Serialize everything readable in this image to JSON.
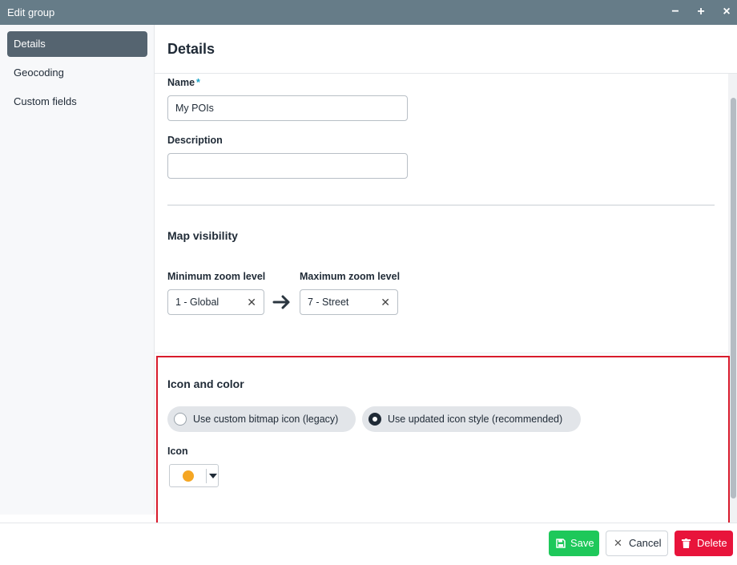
{
  "window": {
    "title": "Edit group",
    "controls": {
      "minimize": "−",
      "maximize": "+",
      "close": "×"
    }
  },
  "sidebar": {
    "items": [
      {
        "label": "Details",
        "active": true
      },
      {
        "label": "Geocoding",
        "active": false
      },
      {
        "label": "Custom fields",
        "active": false
      }
    ]
  },
  "main": {
    "title": "Details",
    "name": {
      "label": "Name",
      "required_mark": "*",
      "value": "My POIs"
    },
    "description": {
      "label": "Description",
      "value": ""
    },
    "map_visibility": {
      "title": "Map visibility",
      "min_zoom": {
        "label": "Minimum zoom level",
        "value": "1 - Global"
      },
      "max_zoom": {
        "label": "Maximum zoom level",
        "value": "7 - Street"
      }
    },
    "icon_and_color": {
      "title": "Icon and color",
      "options": [
        {
          "label": "Use custom bitmap icon (legacy)",
          "checked": false
        },
        {
          "label": "Use updated icon style (recommended)",
          "checked": true
        }
      ],
      "icon_label": "Icon",
      "icon_color": "#f5a623"
    }
  },
  "footer": {
    "save": "Save",
    "cancel": "Cancel",
    "delete": "Delete"
  },
  "colors": {
    "titlebar": "#667c88",
    "active_nav": "#556470",
    "save": "#1ec85a",
    "delete": "#e8143b",
    "highlight": "#d81b2c"
  }
}
